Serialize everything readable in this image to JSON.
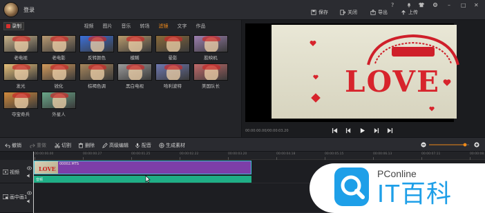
{
  "topbar": {
    "login": "登录",
    "save": "保存",
    "close": "关闭",
    "export": "导出",
    "upload": "上传",
    "help": "?",
    "minimize": "–",
    "maximize": "□",
    "close_win": "✕"
  },
  "media": {
    "record": "录制",
    "tabs": [
      "视频",
      "图片",
      "音乐",
      "转场",
      "滤镜",
      "文字",
      "作品"
    ],
    "active_tab": "滤镜",
    "filters": [
      {
        "label": "老电视",
        "tint": "#c9b38a"
      },
      {
        "label": "老电影",
        "tint": "#b99a72"
      },
      {
        "label": "反转颜色",
        "tint": "#3b6fd8"
      },
      {
        "label": "模糊",
        "tint": "#b89a6c"
      },
      {
        "label": "晕影",
        "tint": "#8a6a3a"
      },
      {
        "label": "胶映机",
        "tint": "#9c7fb0"
      },
      {
        "label": "发光",
        "tint": "#e6c07a"
      },
      {
        "label": "锐化",
        "tint": "#d29a5c"
      },
      {
        "label": "棕褐色调",
        "tint": "#a7865c"
      },
      {
        "label": "黑白电视",
        "tint": "#9a9a9a"
      },
      {
        "label": "哈利波特",
        "tint": "#6e78b0"
      },
      {
        "label": "美国队长",
        "tint": "#c26a6a"
      },
      {
        "label": "夺宝奇兵",
        "tint": "#d28a3c"
      },
      {
        "label": "外星人",
        "tint": "#6aa88a"
      }
    ]
  },
  "preview": {
    "love_text": "LOVE",
    "timecode": "00:00:00.00/00:00:03.20"
  },
  "timeline_toolbar": {
    "undo": "撤销",
    "redo": "重做",
    "cut": "切割",
    "delete": "删除",
    "advanced": "高级编辑",
    "voiceover": "配音",
    "generate": "生成素材"
  },
  "ruler": {
    "ticks": [
      "00:00:00.00",
      "00:00:00.27",
      "00:00:01.25",
      "00:00:02.22",
      "00:00:03.20",
      "00:00:04.18",
      "00:00:05.15",
      "00:00:06.13",
      "00:00:07.11",
      "00:00:08.08"
    ]
  },
  "tracks": {
    "video_label": "视频",
    "pip_label": "画中画1",
    "clip_name": "00002.MTS",
    "audio_name": "音频"
  },
  "watermark": {
    "brand": "PConline",
    "name": "IT百科"
  },
  "colors": {
    "accent": "#f08a1a",
    "clip_video": "#7d3ea8",
    "clip_audio": "#1fae86",
    "brand_blue": "#1e9fe8"
  }
}
